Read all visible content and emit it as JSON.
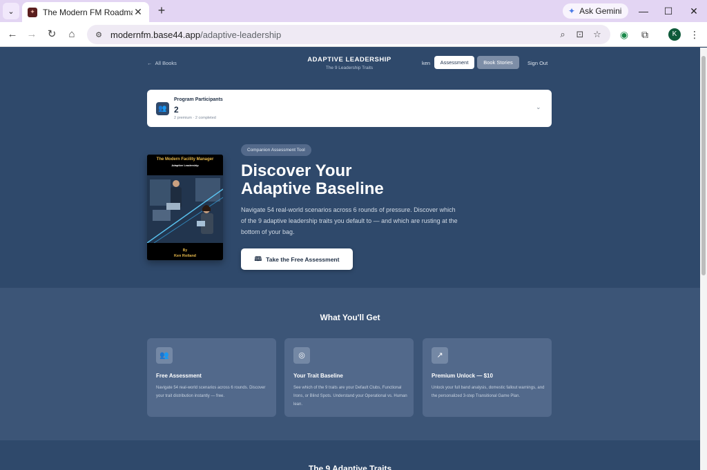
{
  "browser": {
    "tab_title": "The Modern FM Roadmap",
    "new_tab": "+",
    "gemini_label": "Ask Gemini",
    "url_host": "modernfm.base44.app",
    "url_path": "/adaptive-leadership",
    "profile_initial": "K"
  },
  "header": {
    "back_label": "All Books",
    "title": "ADAPTIVE LEADERSHIP",
    "subtitle": "The 9 Leadership Traits",
    "user": "ken",
    "assessment_btn": "Assessment",
    "stories_btn": "Book Stories",
    "sign_out": "Sign Out"
  },
  "participants": {
    "label": "Program Participants",
    "count": "2",
    "meta": "2 premium · 2 completed"
  },
  "book": {
    "title": "The Modern Facility Manager",
    "subtitle": "Adaptive Leadership",
    "by": "By",
    "author": "Ken Roiland"
  },
  "hero": {
    "badge": "Companion Assessment Tool",
    "title_line1": "Discover Your",
    "title_line2": "Adaptive Baseline",
    "description": "Navigate 54 real-world scenarios across 6 rounds of pressure. Discover which of the 9 adaptive leadership traits you default to — and which are rusting at the bottom of your bag.",
    "cta": "Take the Free Assessment"
  },
  "features": {
    "title": "What You'll Get",
    "cards": [
      {
        "icon": "users-icon",
        "title": "Free Assessment",
        "desc": "Navigate 54 real-world scenarios across 6 rounds. Discover your trait distribution instantly — free."
      },
      {
        "icon": "target-icon",
        "title": "Your Trait Baseline",
        "desc": "See which of the 9 traits are your Default Clubs, Functional Irons, or Blind Spots. Understand your Operational vs. Human lean."
      },
      {
        "icon": "trending-up-icon",
        "title": "Premium Unlock — $10",
        "desc": "Unlock your full band analysis, domestic fallout warnings, and the personalized 3-step Transitional Game Plan."
      }
    ]
  },
  "traits_section": {
    "title": "The 9 Adaptive Traits"
  }
}
